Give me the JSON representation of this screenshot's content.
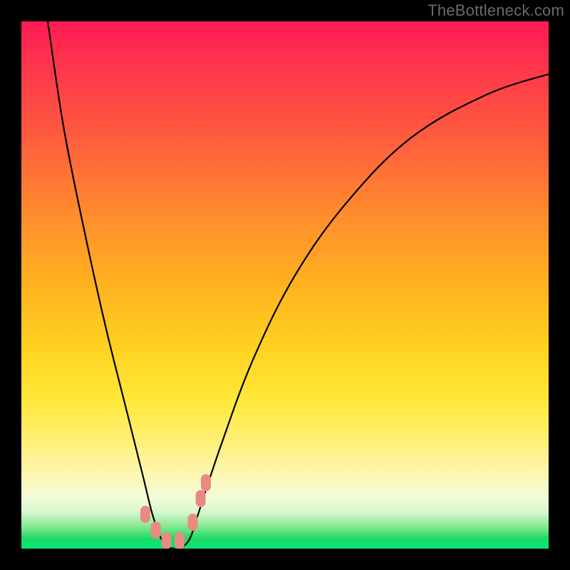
{
  "watermark": "TheBottleneck.com",
  "chart_data": {
    "type": "line",
    "title": "",
    "xlabel": "",
    "ylabel": "",
    "xlim": [
      0,
      100
    ],
    "ylim": [
      0,
      100
    ],
    "series": [
      {
        "name": "bottleneck-curve",
        "x": [
          5,
          8,
          12,
          16,
          20,
          23,
          25,
          27,
          29,
          30,
          32,
          34,
          38,
          44,
          52,
          62,
          74,
          88,
          100
        ],
        "y": [
          100,
          80,
          60,
          42,
          26,
          14,
          6,
          1,
          0,
          0,
          2,
          8,
          20,
          36,
          52,
          66,
          78,
          86,
          90
        ]
      }
    ],
    "markers": [
      {
        "name": "marker",
        "x": 23.5,
        "y": 6.5
      },
      {
        "name": "marker",
        "x": 25.5,
        "y": 3.5
      },
      {
        "name": "marker",
        "x": 27.5,
        "y": 1.5
      },
      {
        "name": "marker",
        "x": 30.0,
        "y": 1.5
      },
      {
        "name": "marker",
        "x": 32.5,
        "y": 5.0
      },
      {
        "name": "marker",
        "x": 34.0,
        "y": 9.5
      },
      {
        "name": "marker",
        "x": 35.0,
        "y": 12.5
      }
    ],
    "gradient_stops": [
      {
        "color": "#ff1a55",
        "pos": 0
      },
      {
        "color": "#ff5c3e",
        "pos": 22
      },
      {
        "color": "#ffb220",
        "pos": 50
      },
      {
        "color": "#ffe83a",
        "pos": 72
      },
      {
        "color": "#00e676",
        "pos": 100
      }
    ]
  }
}
